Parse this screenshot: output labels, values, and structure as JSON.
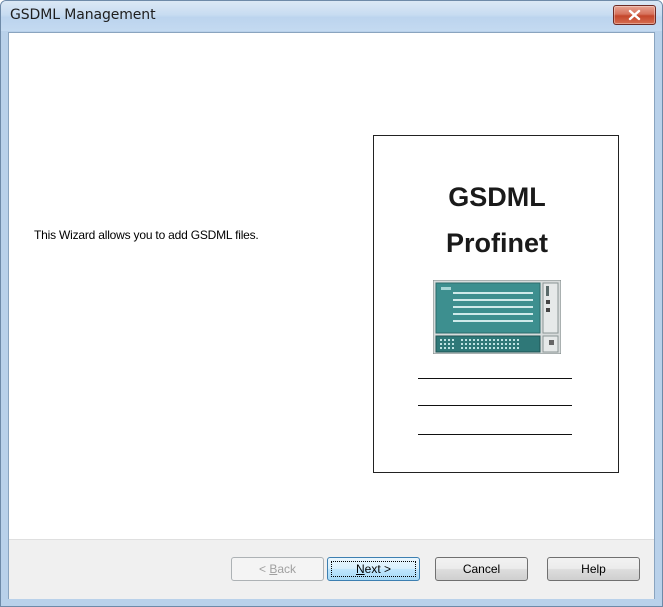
{
  "window": {
    "title": "GSDML Management"
  },
  "intro": {
    "text": "This Wizard allows you to add GSDML files."
  },
  "doc_card": {
    "title_line1": "GSDML",
    "title_line2": "Profinet",
    "image_icon": "profinet-device-icon"
  },
  "buttons": {
    "back_prefix": "< ",
    "back_mnemonic": "B",
    "back_rest": "ack",
    "next_mnemonic": "N",
    "next_rest": "ext >",
    "cancel": "Cancel",
    "help": "Help"
  },
  "colors": {
    "close_button": "#c4462b",
    "title_bar": "#c8dcf1",
    "device_panel": "#3d8f8f"
  }
}
